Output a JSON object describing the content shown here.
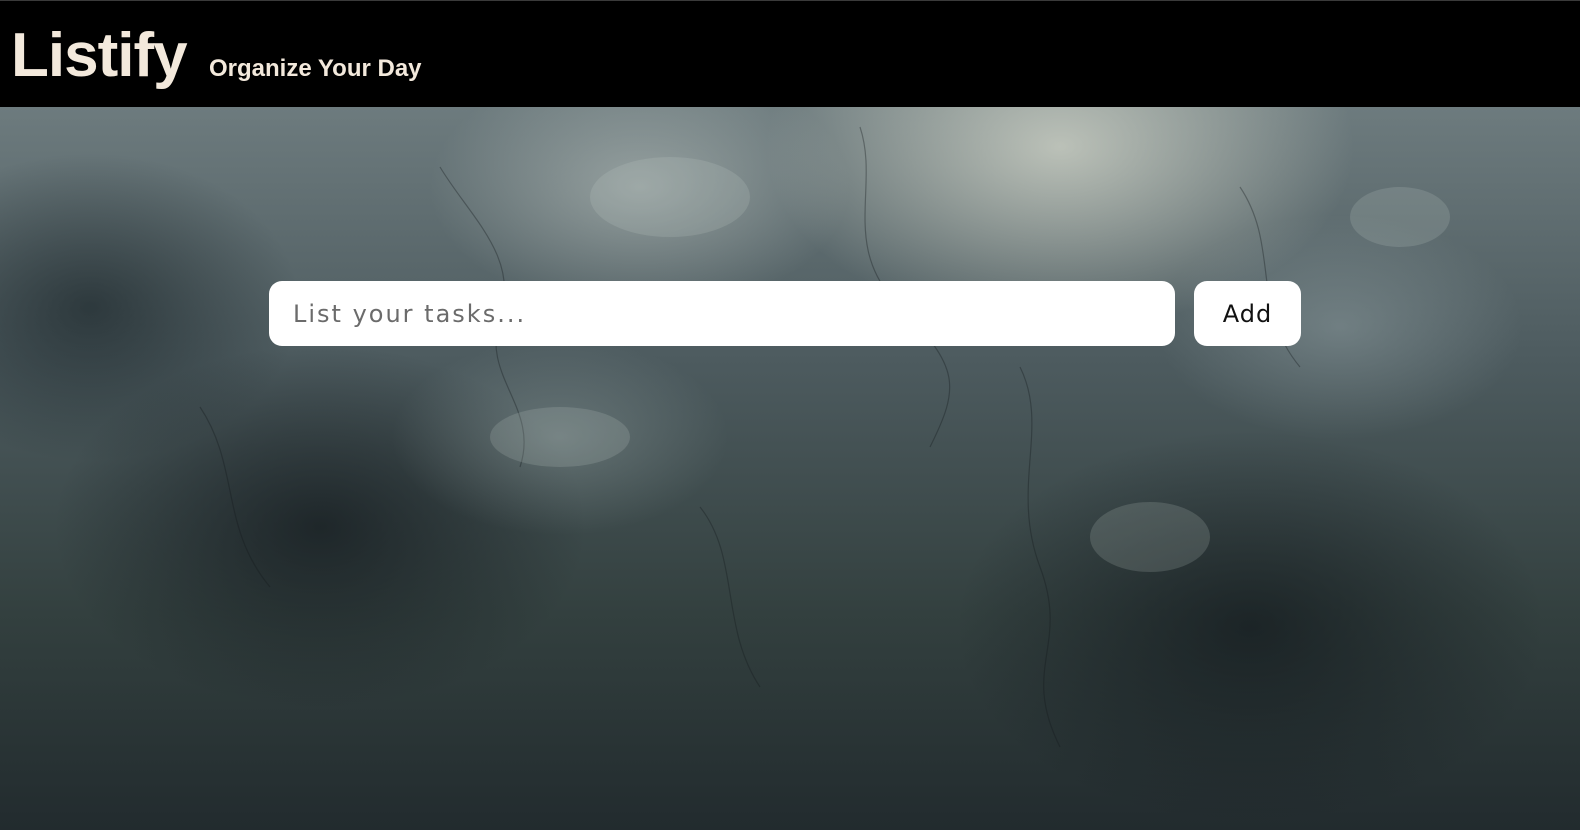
{
  "header": {
    "logo_text": "Listify",
    "tagline": "Organize Your Day"
  },
  "task_form": {
    "input_placeholder": "List your tasks...",
    "input_value": "",
    "add_button_label": "Add"
  },
  "colors": {
    "header_background": "#000000",
    "header_text": "#f3e9dc",
    "input_background": "#ffffff",
    "button_background": "#ffffff"
  }
}
